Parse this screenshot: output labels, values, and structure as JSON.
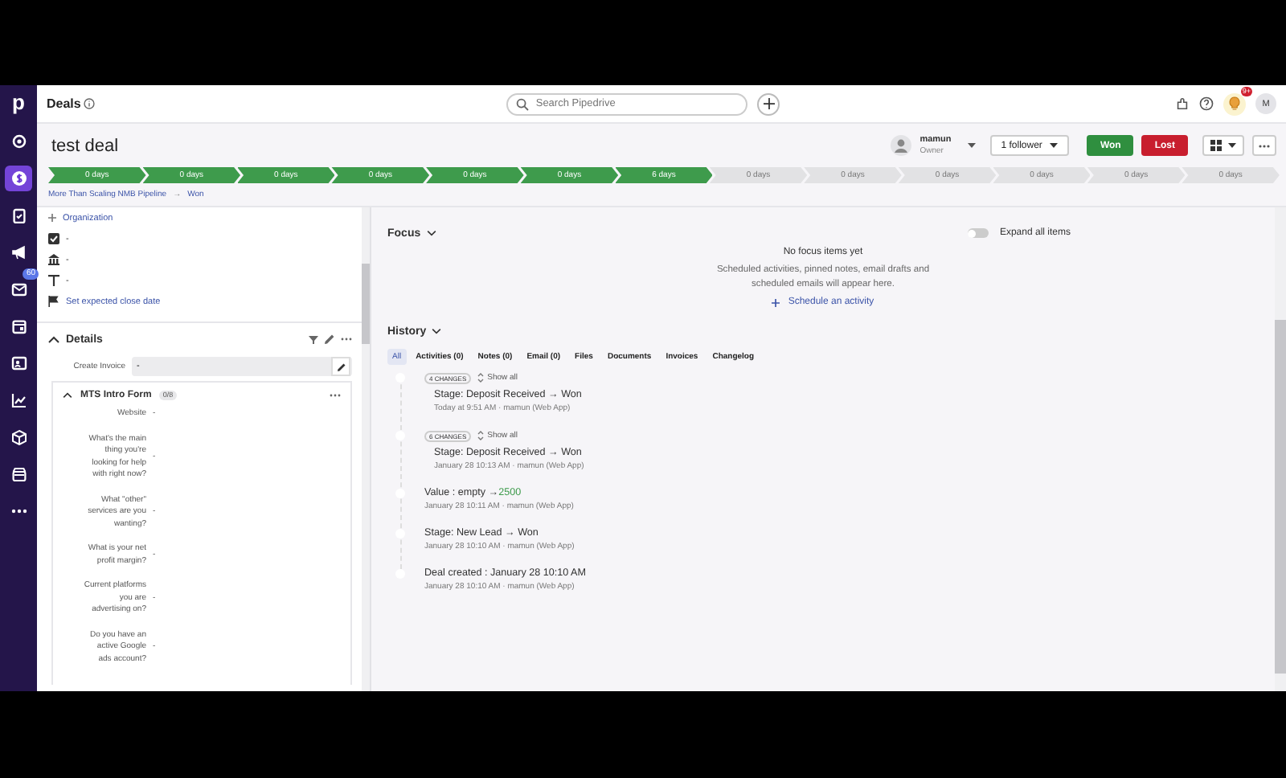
{
  "sidebar": {
    "logo": "p",
    "items": [
      {
        "kind": "target",
        "selected": false
      },
      {
        "kind": "dollar",
        "selected": true
      },
      {
        "kind": "clipboard",
        "selected": false
      },
      {
        "kind": "megaphone",
        "selected": false
      },
      {
        "kind": "mail",
        "selected": false,
        "badge": "60"
      },
      {
        "kind": "calendar",
        "selected": false
      },
      {
        "kind": "contacts",
        "selected": false
      },
      {
        "kind": "chart",
        "selected": false
      },
      {
        "kind": "box",
        "selected": false
      },
      {
        "kind": "store",
        "selected": false
      },
      {
        "kind": "more",
        "selected": false
      }
    ]
  },
  "header": {
    "title": "Deals",
    "search_placeholder": "Search Pipedrive",
    "notification_badge": "9+",
    "avatar": "M"
  },
  "deal": {
    "title": "test deal",
    "owner_name": "mamun",
    "owner_role": "Owner",
    "followers": "1 follower",
    "won": "Won",
    "lost": "Lost"
  },
  "stages": [
    {
      "label": "0 days",
      "done": true
    },
    {
      "label": "0 days",
      "done": true
    },
    {
      "label": "0 days",
      "done": true
    },
    {
      "label": "0 days",
      "done": true
    },
    {
      "label": "0 days",
      "done": true
    },
    {
      "label": "0 days",
      "done": true
    },
    {
      "label": "6 days",
      "done": true
    },
    {
      "label": "0 days",
      "done": false
    },
    {
      "label": "0 days",
      "done": false
    },
    {
      "label": "0 days",
      "done": false
    },
    {
      "label": "0 days",
      "done": false
    },
    {
      "label": "0 days",
      "done": false
    },
    {
      "label": "0 days",
      "done": false
    }
  ],
  "breadcrumb": {
    "pipeline": "More Than Scaling NMB Pipeline",
    "arrow": "→",
    "stage": "Won"
  },
  "summary": {
    "organization": "Organization",
    "rows": [
      {
        "kind": "check",
        "value": "-"
      },
      {
        "kind": "bank",
        "value": "-"
      },
      {
        "kind": "text",
        "value": "-"
      },
      {
        "kind": "flag",
        "value": "Set expected close date"
      }
    ]
  },
  "details": {
    "title": "Details",
    "expanded": true,
    "invoice_label": "Create Invoice",
    "invoice_value": "-",
    "form": {
      "title": "MTS Intro Form",
      "count": "0/8",
      "expanded": true,
      "fields": [
        {
          "label": "Website",
          "value": "-"
        },
        {
          "label": "What's the main thing you're looking for help with right now?",
          "value": "-"
        },
        {
          "label": "What \"other\" services are you wanting?",
          "value": "-"
        },
        {
          "label": "What is your net profit margin?",
          "value": "-"
        },
        {
          "label": "Current platforms you are advertising on?",
          "value": "-"
        },
        {
          "label": "Do you have an active Google ads account?",
          "value": "-"
        }
      ]
    }
  },
  "focus": {
    "title": "Focus",
    "expand_all_label": "Expand all items",
    "expand_all_on": false,
    "empty_title": "No focus items yet",
    "empty_text": "Scheduled activities, pinned notes, email drafts and scheduled emails will appear here.",
    "action": "Schedule an activity"
  },
  "history": {
    "title": "History",
    "tabs": [
      {
        "label": "All",
        "selected": true
      },
      {
        "label": "Activities (0)",
        "selected": false
      },
      {
        "label": "Notes (0)",
        "selected": false
      },
      {
        "label": "Email (0)",
        "selected": false
      },
      {
        "label": "Files",
        "selected": false
      },
      {
        "label": "Documents",
        "selected": false
      },
      {
        "label": "Invoices",
        "selected": false
      },
      {
        "label": "Changelog",
        "selected": false
      }
    ],
    "entries": [
      {
        "kind": "group",
        "changes": "4 CHANGES",
        "show_all": "Show all",
        "title": "Stage: Deposit Received → Won",
        "meta": "Today at 9:51 AM · mamun (Web App)"
      },
      {
        "kind": "group",
        "changes": "6 CHANGES",
        "show_all": "Show all",
        "title": "Stage: Deposit Received → Won",
        "meta": "January 28 10:13 AM · mamun (Web App)"
      },
      {
        "kind": "change",
        "title": "Value : empty →",
        "new_value": "2500",
        "meta": "January 28 10:11 AM · mamun (Web App)"
      },
      {
        "kind": "change",
        "title": "Stage: New Lead → Won",
        "meta": "January 28 10:10 AM · mamun (Web App)"
      },
      {
        "kind": "change",
        "title": "Deal created : January 28 10:10 AM",
        "meta": "January 28 10:10 AM · mamun (Web App)"
      }
    ]
  }
}
